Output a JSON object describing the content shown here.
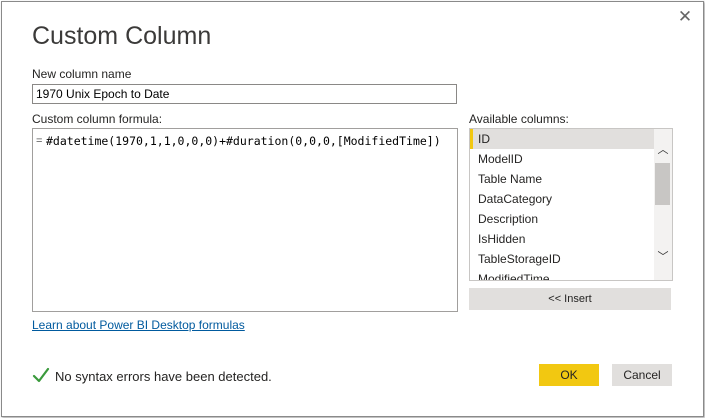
{
  "dialog": {
    "title": "Custom Column",
    "close_symbol": "✕"
  },
  "new_column": {
    "label": "New column name",
    "value": "1970 Unix Epoch to Date"
  },
  "formula": {
    "label": "Custom column formula:",
    "equals": "=",
    "text": "#datetime(1970,1,1,0,0,0)+#duration(0,0,0,[ModifiedTime])"
  },
  "available_columns": {
    "label": "Available columns:",
    "items": [
      {
        "label": "ID",
        "selected": true
      },
      {
        "label": "ModelID"
      },
      {
        "label": "Table Name"
      },
      {
        "label": "DataCategory"
      },
      {
        "label": "Description"
      },
      {
        "label": "IsHidden"
      },
      {
        "label": "TableStorageID"
      },
      {
        "label": "ModifiedTime"
      }
    ],
    "scroll_up": "︿",
    "scroll_down": "﹀"
  },
  "insert_button": "<< Insert",
  "learn_link": "Learn about Power BI Desktop formulas",
  "status": {
    "icon": "checkmark-icon",
    "text": "No syntax errors have been detected."
  },
  "buttons": {
    "ok": "OK",
    "cancel": "Cancel"
  },
  "colors": {
    "accent": "#f2c811",
    "selected_bg": "#e1dfdd",
    "link": "#005a9e",
    "success": "#3a9a3c"
  }
}
